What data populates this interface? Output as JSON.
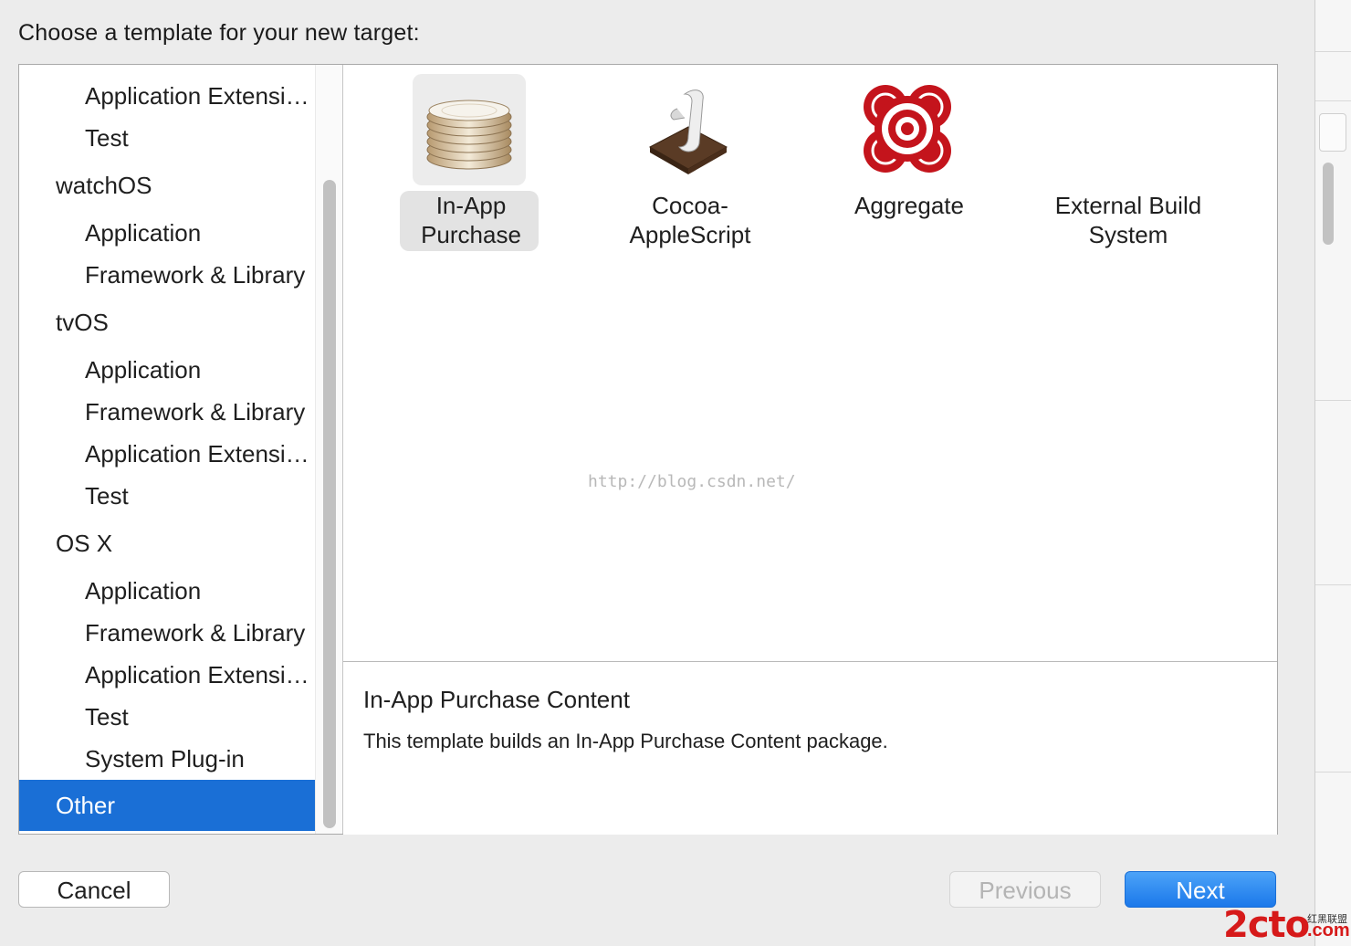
{
  "prompt": "Choose a template for your new target:",
  "sidebar": {
    "items": [
      {
        "label": "Application Extensi…",
        "kind": "child"
      },
      {
        "label": "Test",
        "kind": "child"
      },
      {
        "label": "watchOS",
        "kind": "group"
      },
      {
        "label": "Application",
        "kind": "child"
      },
      {
        "label": "Framework & Library",
        "kind": "child"
      },
      {
        "label": "tvOS",
        "kind": "group"
      },
      {
        "label": "Application",
        "kind": "child"
      },
      {
        "label": "Framework & Library",
        "kind": "child"
      },
      {
        "label": "Application Extensi…",
        "kind": "child"
      },
      {
        "label": "Test",
        "kind": "child"
      },
      {
        "label": "OS X",
        "kind": "group"
      },
      {
        "label": "Application",
        "kind": "child"
      },
      {
        "label": "Framework & Library",
        "kind": "child"
      },
      {
        "label": "Application Extensi…",
        "kind": "child"
      },
      {
        "label": "Test",
        "kind": "child"
      },
      {
        "label": "System Plug-in",
        "kind": "child"
      },
      {
        "label": "Other",
        "kind": "group",
        "selected": true
      }
    ]
  },
  "templates": [
    {
      "line1": "In-App",
      "line2": "Purchase",
      "icon": "coins-icon",
      "selected": true
    },
    {
      "line1": "Cocoa-",
      "line2": "AppleScript",
      "icon": "script-scroll-icon",
      "selected": false
    },
    {
      "line1": "Aggregate",
      "line2": "",
      "icon": "target-icon",
      "selected": false
    },
    {
      "line1": "External Build",
      "line2": "System",
      "icon": "",
      "selected": false
    }
  ],
  "watermark": "http://blog.csdn.net/",
  "detail": {
    "title": "In-App Purchase Content",
    "description": "This template builds an In-App Purchase Content package."
  },
  "buttons": {
    "cancel": "Cancel",
    "previous": "Previous",
    "next": "Next"
  },
  "logo": {
    "main": "2cto",
    "small": "红黑联盟",
    "suffix": ".com"
  },
  "colors": {
    "selection": "#1a6fd6",
    "next_button": "#1b78ea"
  }
}
